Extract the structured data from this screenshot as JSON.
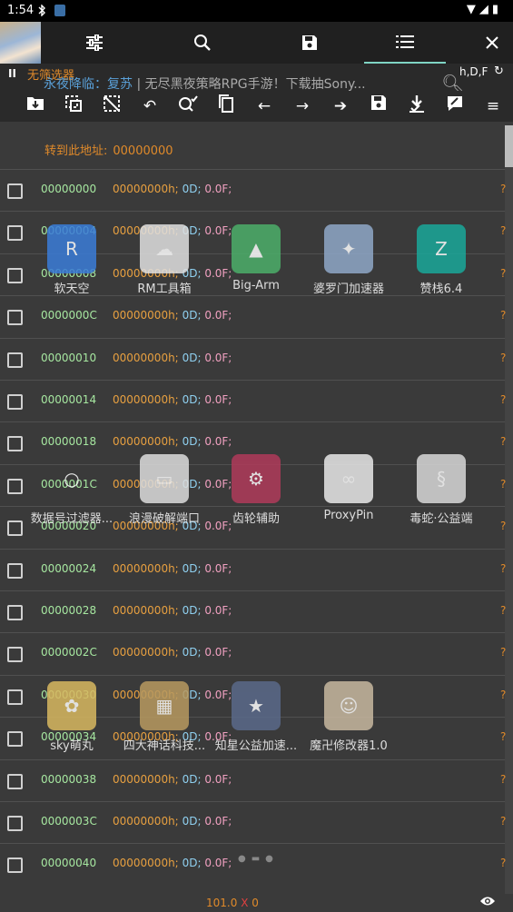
{
  "status_bar": {
    "time": "1:54",
    "signal_glyphs": "▼◢▮"
  },
  "toolbar": {
    "tabs": [
      {
        "icon": "sliders-icon"
      },
      {
        "icon": "search-icon"
      },
      {
        "icon": "save-icon"
      },
      {
        "icon": "list-icon",
        "active": true
      },
      {
        "icon": "close-icon"
      }
    ]
  },
  "filter_bar": {
    "pause_label": "II",
    "filter_label": "无筛选器",
    "hdf_label": "h,D,F",
    "banner_prefix": "永夜降临：复苏",
    "banner_text": "无尽黑夜策略RPG手游！下载抽Sony..."
  },
  "goto": {
    "label": "转到此地址:",
    "address": "00000000"
  },
  "rows": [
    {
      "addr": "00000000",
      "hex": "00000000h;",
      "d": "0D;",
      "f": "0.0F;"
    },
    {
      "addr": "00000004",
      "hex": "00000000h;",
      "d": "0D;",
      "f": "0.0F;"
    },
    {
      "addr": "00000008",
      "hex": "00000000h;",
      "d": "0D;",
      "f": "0.0F;"
    },
    {
      "addr": "0000000C",
      "hex": "00000000h;",
      "d": "0D;",
      "f": "0.0F;"
    },
    {
      "addr": "00000010",
      "hex": "00000000h;",
      "d": "0D;",
      "f": "0.0F;"
    },
    {
      "addr": "00000014",
      "hex": "00000000h;",
      "d": "0D;",
      "f": "0.0F;"
    },
    {
      "addr": "00000018",
      "hex": "00000000h;",
      "d": "0D;",
      "f": "0.0F;"
    },
    {
      "addr": "0000001C",
      "hex": "00000000h;",
      "d": "0D;",
      "f": "0.0F;"
    },
    {
      "addr": "00000020",
      "hex": "00000000h;",
      "d": "0D;",
      "f": "0.0F;"
    },
    {
      "addr": "00000024",
      "hex": "00000000h;",
      "d": "0D;",
      "f": "0.0F;"
    },
    {
      "addr": "00000028",
      "hex": "00000000h;",
      "d": "0D;",
      "f": "0.0F;"
    },
    {
      "addr": "0000002C",
      "hex": "00000000h;",
      "d": "0D;",
      "f": "0.0F;"
    },
    {
      "addr": "00000030",
      "hex": "00000000h;",
      "d": "0D;",
      "f": "0.0F;"
    },
    {
      "addr": "00000034",
      "hex": "00000000h;",
      "d": "0D;",
      "f": "0.0F;"
    },
    {
      "addr": "00000038",
      "hex": "00000000h;",
      "d": "0D;",
      "f": "0.0F;"
    },
    {
      "addr": "0000003C",
      "hex": "00000000h;",
      "d": "0D;",
      "f": "0.0F;"
    },
    {
      "addr": "00000040",
      "hex": "00000000h;",
      "d": "0D;",
      "f": "0.0F;"
    }
  ],
  "row_suffix": "?",
  "apps": [
    {
      "label": "软天空",
      "color": "#3a7cd8",
      "glyph": "R"
    },
    {
      "label": "RM工具箱",
      "color": "#e0e0e0",
      "glyph": "☁"
    },
    {
      "label": "Big-Arm",
      "color": "#4caf6a",
      "glyph": "▲"
    },
    {
      "label": "婆罗门加速器",
      "color": "#8fa8c8",
      "glyph": "✦"
    },
    {
      "label": "赞栈6.4",
      "color": "#1aa89a",
      "glyph": "Z"
    },
    {
      "label": "数据号过滤器...",
      "color": "transparent",
      "glyph": "○"
    },
    {
      "label": "浪漫破解端口",
      "color": "#dddddd",
      "glyph": "▭"
    },
    {
      "label": "齿轮辅助",
      "color": "#b03a5a",
      "glyph": "⚙"
    },
    {
      "label": "ProxyPin",
      "color": "#e8e8e8",
      "glyph": "∞"
    },
    {
      "label": "毒蛇·公益端",
      "color": "#d8d8d8",
      "glyph": "§"
    },
    {
      "label": "sky萌丸",
      "color": "#d8b860",
      "glyph": "✿"
    },
    {
      "label": "四大神话科技...",
      "color": "#b89a60",
      "glyph": "▦"
    },
    {
      "label": "知星公益加速...",
      "color": "#5a6a8a",
      "glyph": "★"
    },
    {
      "label": "魔卍修改器1.0",
      "color": "#c8b8a0",
      "glyph": "☺"
    }
  ],
  "bottom": {
    "count": "101.0",
    "sep": "X",
    "value": "0"
  }
}
